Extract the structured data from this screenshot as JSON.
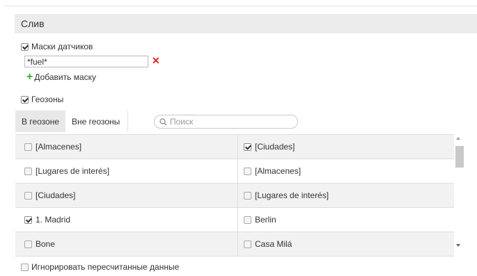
{
  "section": {
    "title": "Слив"
  },
  "sensor_masks": {
    "label": "Маски датчиков",
    "checked": true,
    "mask_value": "*fuel*",
    "remove_icon": "close-icon",
    "add_label": "Добавить маску",
    "add_icon": "plus-icon"
  },
  "geozones": {
    "label": "Геозоны",
    "checked": true,
    "tabs": [
      {
        "label": "В геозоне",
        "active": true
      },
      {
        "label": "Вне геозоны",
        "active": false
      }
    ],
    "search": {
      "placeholder": "Поиск",
      "value": ""
    },
    "rows": [
      {
        "left": {
          "label": "[Almacenes]",
          "checked": false
        },
        "right": {
          "label": "[Ciudades]",
          "checked": true
        }
      },
      {
        "left": {
          "label": "[Lugares de interés]",
          "checked": false
        },
        "right": {
          "label": "[Almacenes]",
          "checked": false
        }
      },
      {
        "left": {
          "label": "[Ciudades]",
          "checked": false
        },
        "right": {
          "label": "[Lugares de interés]",
          "checked": false
        }
      },
      {
        "left": {
          "label": "1. Madrid",
          "checked": true
        },
        "right": {
          "label": "Berlin",
          "checked": false
        }
      },
      {
        "left": {
          "label": "Bone",
          "checked": false
        },
        "right": {
          "label": "Casa Milá",
          "checked": false
        }
      }
    ]
  },
  "ignore_recalculated": {
    "label": "Игнорировать пересчитанные данные",
    "checked": false
  },
  "colors": {
    "remove": "#e02020",
    "add": "#3aa83a",
    "header_bg": "#ececec",
    "row_shade": "#f2f2f2"
  }
}
